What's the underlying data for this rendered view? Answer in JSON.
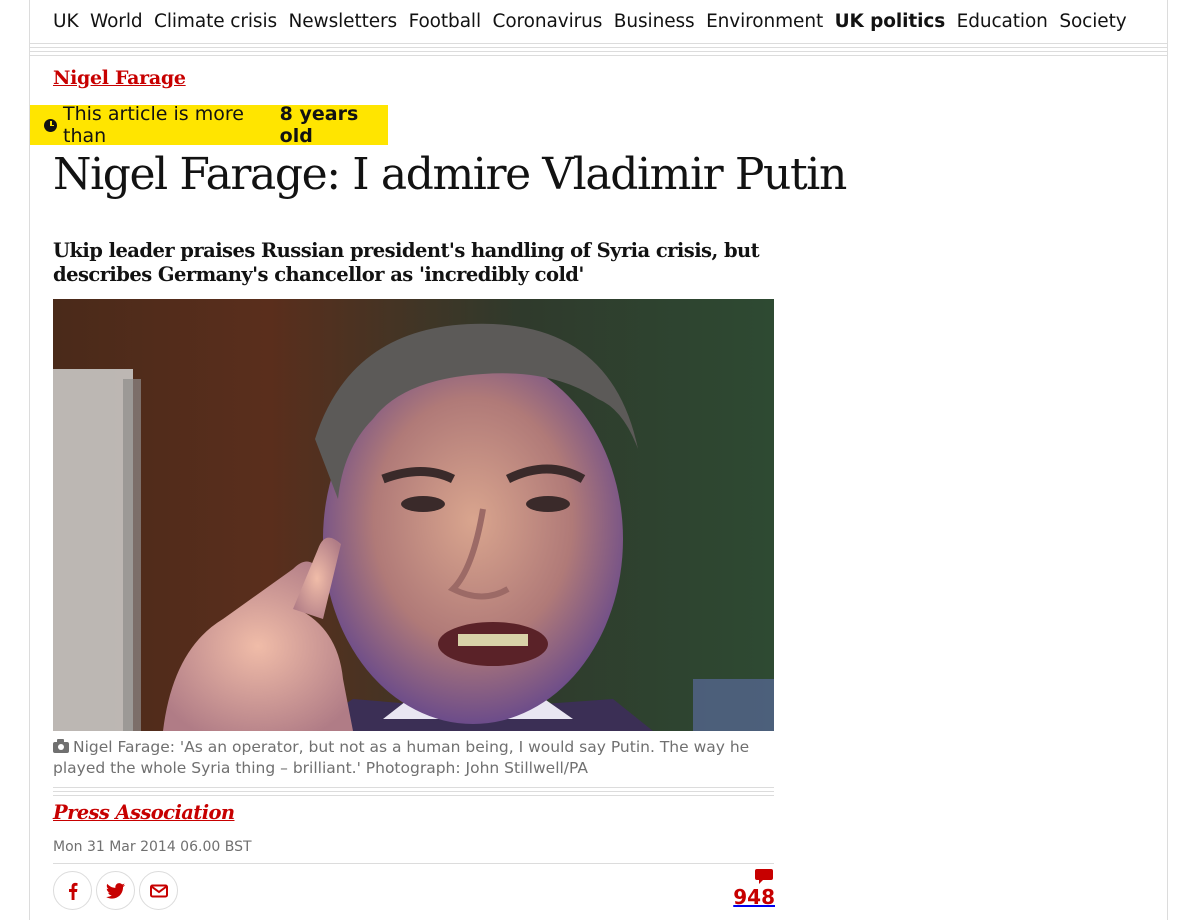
{
  "nav": {
    "items": [
      "UK",
      "World",
      "Climate crisis",
      "Newsletters",
      "Football",
      "Coronavirus",
      "Business",
      "Environment",
      "UK politics",
      "Education",
      "Society"
    ],
    "active": "UK politics"
  },
  "article": {
    "section": "Nigel Farage",
    "age_banner": {
      "prefix": "This article is more than",
      "age": "8 years old"
    },
    "headline": "Nigel Farage: I admire Vladimir Putin",
    "standfirst": "Ukip leader praises Russian president's handling of Syria crisis, but describes Germany's chancellor as 'incredibly cold'",
    "caption": "Nigel Farage: 'As an operator, but not as a human being, I would say Putin. The way he played the whole Syria thing – brilliant.' Photograph: John Stillwell/PA",
    "byline": "Press Association",
    "date": "Mon 31 Mar 2014 06.00 BST",
    "comment_count": "948"
  },
  "colors": {
    "brand_red": "#c70000",
    "banner_yellow": "#ffe500",
    "rule": "#dcdcdc",
    "muted": "#707070"
  },
  "icons": [
    "clock-icon",
    "camera-icon",
    "facebook-icon",
    "twitter-icon",
    "email-icon",
    "comment-icon"
  ]
}
